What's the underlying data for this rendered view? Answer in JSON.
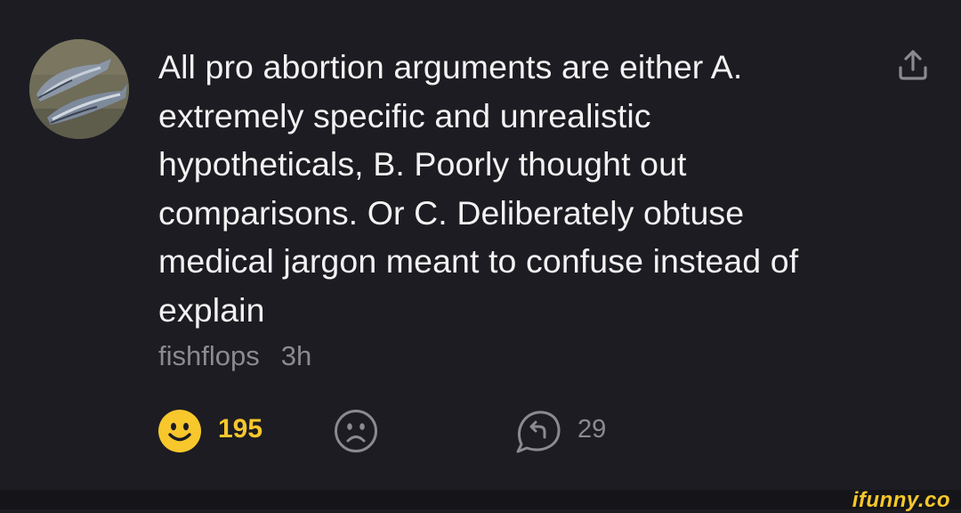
{
  "comment": {
    "text": "All pro abortion arguments are either A. extremely specific and unrealistic hypotheticals, B. Poorly thought out comparisons. Or C. Deliberately obtuse medical jargon meant to confuse instead of explain",
    "username": "fishflops",
    "time": "3h",
    "smiles": "195",
    "replies": "29"
  },
  "icons": {
    "avatar": "fish-avatar",
    "share": "share-icon",
    "smile": "smile-icon",
    "unsmile": "unsmile-icon",
    "reply": "reply-icon"
  },
  "colors": {
    "background": "#1c1c22",
    "text": "#f2f2f2",
    "muted": "#8a8a90",
    "accent": "#f7c72b"
  },
  "watermark": "ifunny.co"
}
